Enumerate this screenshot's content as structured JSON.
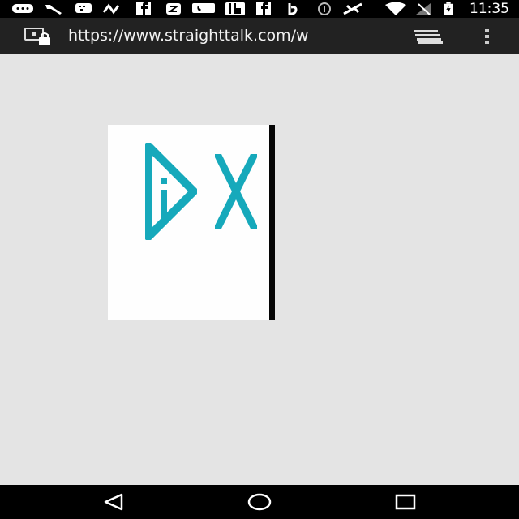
{
  "status_bar": {
    "time": "11:35",
    "icons": [
      "chat-bubble-icon",
      "wrench-icon",
      "blackberry-messenger-icon",
      "sound-wave-icon",
      "facebook-icon",
      "notification-2-icon",
      "phone-message-icon",
      "ib-icon",
      "facebook-icon",
      "b-app-icon",
      "nfc-icon",
      "satellite-icon",
      "wifi-icon",
      "no-signal-icon",
      "battery-charging-icon"
    ]
  },
  "browser": {
    "url": "https://www.straighttalk.com/w",
    "site_info_icon": "site-security-lock-icon",
    "tabs_icon": "tabs-stack-icon",
    "menu_icon": "overflow-menu-icon"
  },
  "ad": {
    "adchoices_icon": "adchoices-icon",
    "close_icon": "close-icon",
    "accent_color": "#16a9bb"
  },
  "nav_bar": {
    "back_icon": "back-icon",
    "home_icon": "home-icon",
    "recents_icon": "recents-icon"
  }
}
